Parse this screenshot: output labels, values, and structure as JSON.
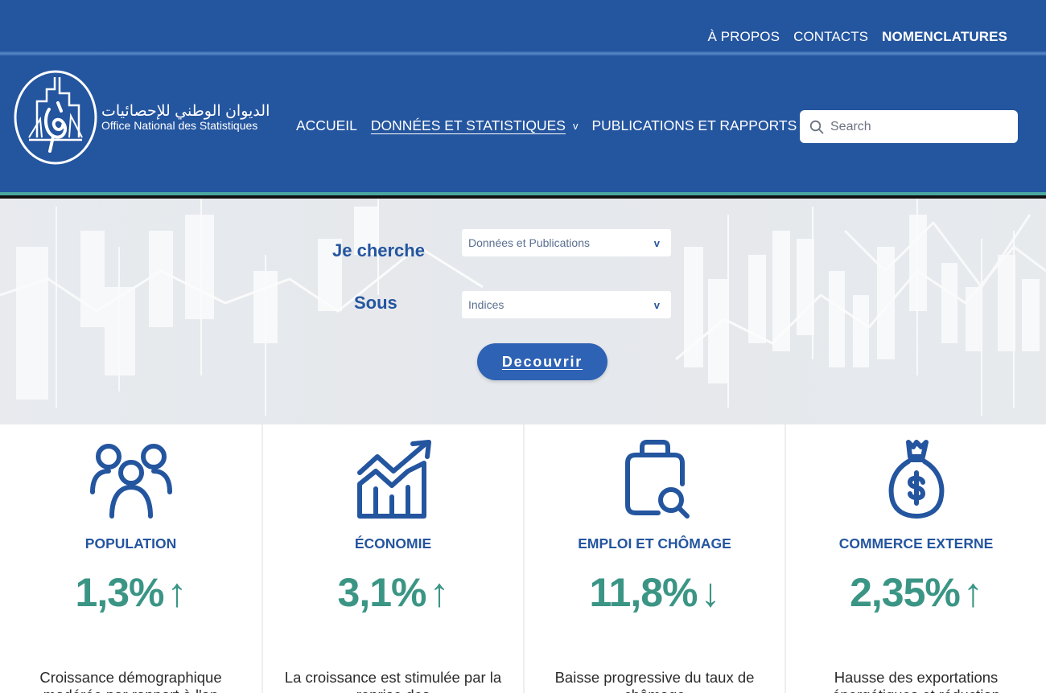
{
  "top_nav": {
    "about": "À PROPOS",
    "contacts": "CONTACTS",
    "nomenclatures": "NOMENCLATURES"
  },
  "logo": {
    "arabic": "الديوان الوطني للإحصائيات",
    "french": "Office National des Statistiques"
  },
  "main_nav": {
    "home": "ACCUEIL",
    "data": "DONNÉES ET STATISTIQUES",
    "data_chevron": "v",
    "publications": "PUBLICATIONS ET RAPPORTS"
  },
  "search": {
    "placeholder": "Search",
    "icon": "search-icon"
  },
  "finder": {
    "search_label": "Je cherche",
    "under_label": "Sous",
    "select_1": "Données et Publications",
    "select_2": "Indices",
    "select_arrow": "v",
    "button": "Decouvrir"
  },
  "stats": [
    {
      "icon": "people-icon",
      "title": "POPULATION",
      "value": "1,3%",
      "arrow": "↑",
      "desc": "Croissance démographique modérée par rapport à l'an"
    },
    {
      "icon": "growth-chart-icon",
      "title": "ÉCONOMIE",
      "value": "3,1%",
      "arrow": "↑",
      "desc": "La croissance est stimulée par la reprise des"
    },
    {
      "icon": "job-search-icon",
      "title": "EMPLOI ET CHÔMAGE",
      "value": "11,8%",
      "arrow": "↓",
      "desc": "Baisse progressive du taux de chômage"
    },
    {
      "icon": "money-bag-icon",
      "title": "COMMERCE EXTERNE",
      "value": "2,35%",
      "arrow": "↑",
      "desc": "Hausse des exportations énergétiques et réduction"
    }
  ],
  "colors": {
    "brand_blue": "#24559f",
    "teal": "#3b9585",
    "accent_line": "#4aa8a0"
  }
}
